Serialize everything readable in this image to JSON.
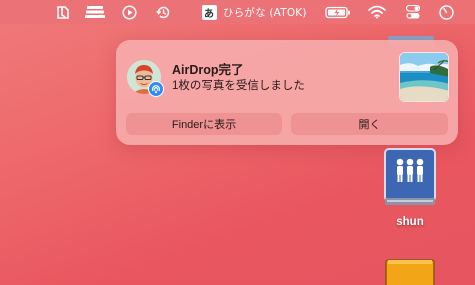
{
  "menubar": {
    "icons": [
      "finder-window-icon",
      "stack-icon",
      "play-icon",
      "time-machine-icon",
      "input-method-icon",
      "battery-icon",
      "wifi-icon",
      "control-center-icon",
      "clock-icon"
    ],
    "input_method_glyph": "あ",
    "input_method_label": "ひらがな (ATOK)"
  },
  "notification": {
    "title": "AirDrop完了",
    "body": "1枚の写真を受信しました",
    "badge_icon": "airdrop-icon",
    "buttons": {
      "show_in_finder": "Finderに表示",
      "open": "開く"
    }
  },
  "desktop": {
    "drive_label": "shun"
  },
  "colors": {
    "wallpaper": "#ee6a6c",
    "notification_bg": "#f6aaaa",
    "airdrop_blue": "#2f8df5",
    "drive_blue": "#3e67b3"
  }
}
